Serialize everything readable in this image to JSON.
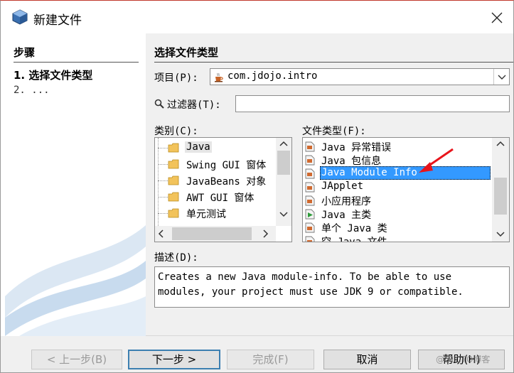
{
  "window": {
    "title": "新建文件"
  },
  "steps": {
    "title": "步骤",
    "items": [
      "1. 选择文件类型",
      "2. ..."
    ]
  },
  "content": {
    "title": "选择文件类型",
    "project_label": "项目(P):",
    "project_value": "com.jdojo.intro",
    "filter_label": "过滤器(T):",
    "filter_value": "",
    "category_label": "类别(C):",
    "filetype_label": "文件类型(F):",
    "categories": [
      "Java",
      "Swing GUI 窗体",
      "JavaBeans 对象",
      "AWT GUI 窗体",
      "单元测试"
    ],
    "selected_category": "Java",
    "file_types": [
      "Java 异常错误",
      "Java 包信息",
      "Java Module Info",
      "JApplet",
      "小应用程序",
      "Java 主类",
      "单个 Java 类",
      "空 Java 文件"
    ],
    "selected_file_type": "Java Module Info",
    "description_label": "描述(D):",
    "description": "Creates a new Java module-info. To be able to use\nmodules, your project must use JDK 9 or compatible."
  },
  "buttons": {
    "back": "< 上一步(B)",
    "next": "下一步 >",
    "finish": "完成(F)",
    "cancel": "取消",
    "help": "帮助(H)"
  },
  "colors": {
    "selection": "#3399ff",
    "annotation_arrow": "#e8141b",
    "default_button_border": "#3c7fb1"
  },
  "watermark": "@51CTO博客"
}
